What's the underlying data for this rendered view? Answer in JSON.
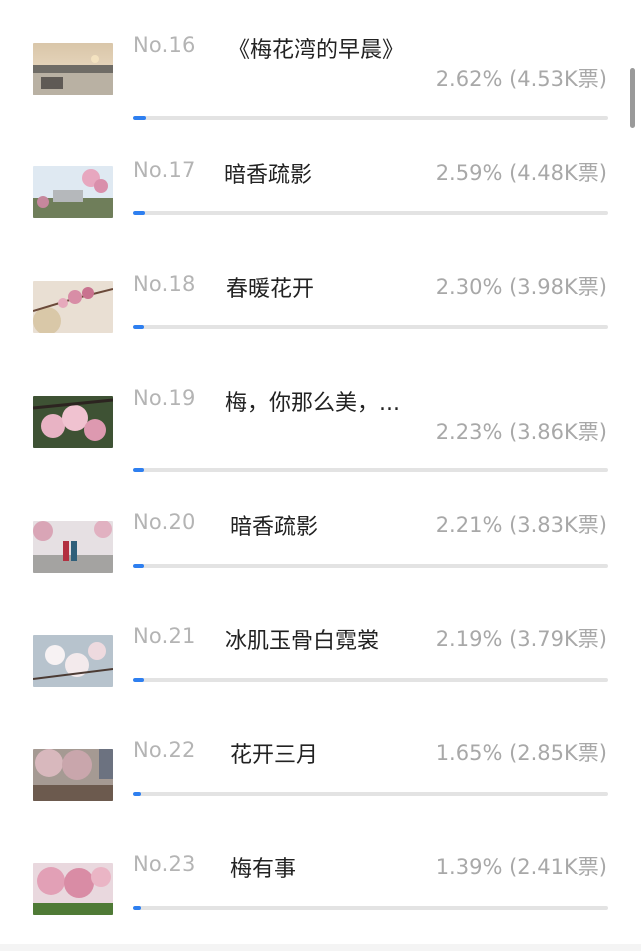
{
  "items": [
    {
      "rank": "No.16",
      "title": "《梅花湾的早晨》",
      "stat": "2.62% (4.53K票)",
      "percent": 2.62,
      "thumbnail": "lake-sunrise-photo"
    },
    {
      "rank": "No.17",
      "title": "暗香疏影",
      "stat": "2.59% (4.48K票)",
      "percent": 2.59,
      "thumbnail": "plum-blossom-town-photo"
    },
    {
      "rank": "No.18",
      "title": "春暖花开",
      "stat": "2.30% (3.98K票)",
      "percent": 2.3,
      "thumbnail": "plum-branch-photo"
    },
    {
      "rank": "No.19",
      "title": "梅，你那么美，...",
      "stat": "2.23% (3.86K票)",
      "percent": 2.23,
      "thumbnail": "pink-blossom-closeup-photo"
    },
    {
      "rank": "No.20",
      "title": "暗香疏影",
      "stat": "2.21% (3.83K票)",
      "percent": 2.21,
      "thumbnail": "people-under-blossom-photo"
    },
    {
      "rank": "No.21",
      "title": "冰肌玉骨白霓裳",
      "stat": "2.19% (3.79K票)",
      "percent": 2.19,
      "thumbnail": "white-plum-blossom-photo"
    },
    {
      "rank": "No.22",
      "title": "花开三月",
      "stat": "1.65% (2.85K票)",
      "percent": 1.65,
      "thumbnail": "blossom-grove-photo"
    },
    {
      "rank": "No.23",
      "title": "梅有事",
      "stat": "1.39% (2.41K票)",
      "percent": 1.39,
      "thumbnail": "pink-plum-tree-photo"
    }
  ],
  "colors": {
    "accent": "#2e7ff0",
    "track": "#e3e3e3",
    "muted_text": "#b4b4b4",
    "title_text": "#222222"
  }
}
